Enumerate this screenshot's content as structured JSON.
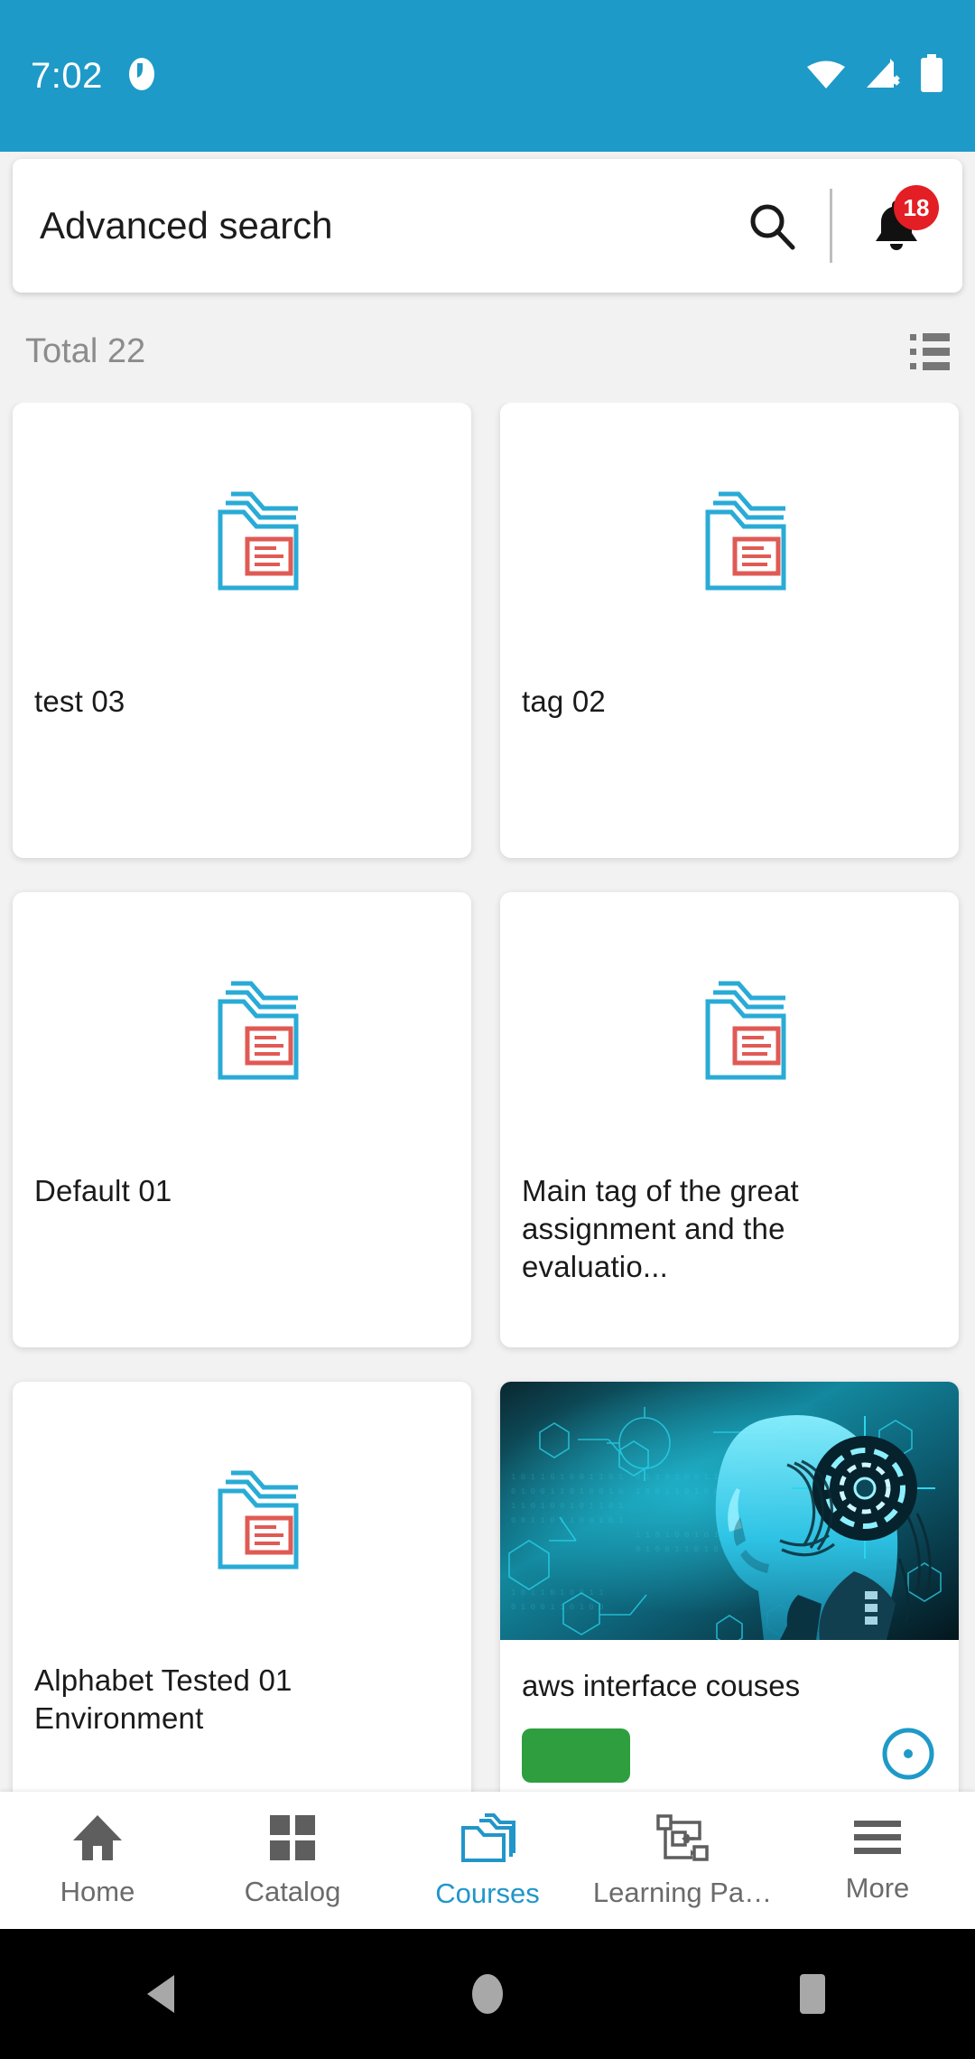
{
  "status_bar": {
    "clock": "7:02",
    "app_icon": "app-notification-icon",
    "wifi_icon": "wifi-icon",
    "cellular_icon": "cellular-no-sim-icon",
    "battery_icon": "battery-full-icon",
    "background_color": "#1E9AC8"
  },
  "search": {
    "value": "Advanced search",
    "placeholder": "Advanced search",
    "search_icon": "search-icon",
    "bell_icon": "notification-bell-icon",
    "notification_count": "18",
    "badge_color": "#E31E24"
  },
  "results": {
    "total_label": "Total 22",
    "view_toggle_icon": "list-view-toggle-icon"
  },
  "cards": [
    {
      "title": "test 03",
      "thumb": "folder-document-icon",
      "has_image": false
    },
    {
      "title": "tag 02",
      "thumb": "folder-document-icon",
      "has_image": false
    },
    {
      "title": "Default 01",
      "thumb": "folder-document-icon",
      "has_image": false
    },
    {
      "title": "Main tag of the great assignment and the evaluatio...",
      "thumb": "folder-document-icon",
      "has_image": false
    },
    {
      "title": "Alphabet Tested 01 Environment",
      "thumb": "folder-document-icon",
      "has_image": false
    },
    {
      "title": "aws interface couses",
      "thumb": "ai-robot-head-image",
      "has_image": true,
      "badge": "",
      "badge_color": "#2E9E3E"
    }
  ],
  "bottom_nav": {
    "items": [
      {
        "label": "Home",
        "icon": "home-icon",
        "active": false
      },
      {
        "label": "Catalog",
        "icon": "grid-squares-icon",
        "active": false
      },
      {
        "label": "Courses",
        "icon": "folders-icon",
        "active": true
      },
      {
        "label": "Learning Pa…",
        "icon": "learning-path-flowchart-icon",
        "active": false
      },
      {
        "label": "More",
        "icon": "hamburger-menu-icon",
        "active": false
      }
    ],
    "active_color": "#2196C9",
    "inactive_color": "#6b6b6b"
  },
  "system_nav": {
    "back_icon": "back-triangle-icon",
    "home_icon": "home-circle-icon",
    "recents_icon": "recents-square-icon"
  },
  "theme": {
    "accent": "#1E9AC8",
    "folder_cyan": "#29ABD6",
    "doc_red": "#E05A54",
    "page_bg": "#f2f2f2"
  }
}
